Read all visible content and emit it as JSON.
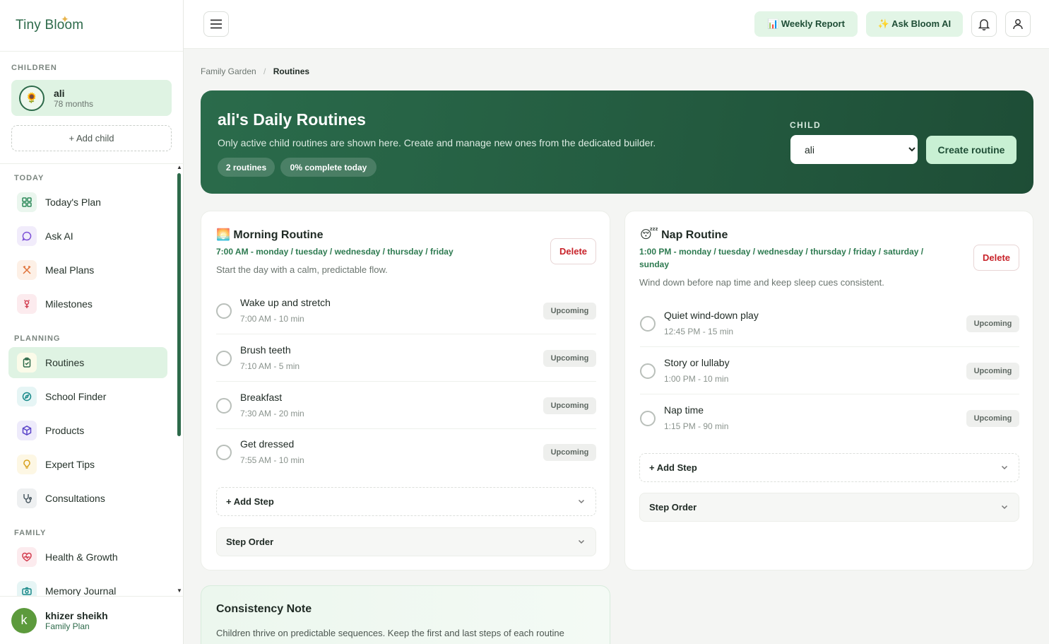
{
  "app": {
    "logo_text": "Tiny Bloom"
  },
  "sidebar": {
    "children_title": "CHILDREN",
    "child": {
      "name": "ali",
      "age": "78 months",
      "avatar": "🌻"
    },
    "add_child": "+ Add child",
    "sections": {
      "today": "TODAY",
      "planning": "PLANNING",
      "family": "FAMILY"
    },
    "items": [
      {
        "label": "Today's Plan",
        "icon": "grid-icon"
      },
      {
        "label": "Ask AI",
        "icon": "chat-icon"
      },
      {
        "label": "Meal Plans",
        "icon": "utensils-icon"
      },
      {
        "label": "Milestones",
        "icon": "flower-icon"
      },
      {
        "label": "Routines",
        "icon": "clipboard-icon"
      },
      {
        "label": "School Finder",
        "icon": "compass-icon"
      },
      {
        "label": "Products",
        "icon": "box-icon"
      },
      {
        "label": "Expert Tips",
        "icon": "lightbulb-icon"
      },
      {
        "label": "Consultations",
        "icon": "stethoscope-icon"
      },
      {
        "label": "Health & Growth",
        "icon": "heart-pulse-icon"
      },
      {
        "label": "Memory Journal",
        "icon": "camera-icon"
      }
    ],
    "user": {
      "initial": "k",
      "name": "khizer sheikh",
      "plan": "Family Plan"
    }
  },
  "topbar": {
    "weekly_report": "📊 Weekly Report",
    "ask_ai": "✨ Ask Bloom AI"
  },
  "breadcrumb": {
    "root": "Family Garden",
    "separator": "/",
    "current": "Routines"
  },
  "hero": {
    "title": "ali's Daily Routines",
    "subtitle": "Only active child routines are shown here. Create and manage new ones from the dedicated builder.",
    "chips": [
      "2 routines",
      "0% complete today"
    ],
    "child_label": "CHILD",
    "child_selected": "ali",
    "create_button": "Create routine"
  },
  "routines": [
    {
      "emoji": "🌅",
      "title": "Morning Routine",
      "schedule": "7:00 AM - monday / tuesday / wednesday / thursday / friday",
      "description": "Start the day with a calm, predictable flow.",
      "delete_label": "Delete",
      "steps": [
        {
          "name": "Wake up and stretch",
          "meta": "7:00 AM - 10 min",
          "status": "Upcoming"
        },
        {
          "name": "Brush teeth",
          "meta": "7:10 AM - 5 min",
          "status": "Upcoming"
        },
        {
          "name": "Breakfast",
          "meta": "7:30 AM - 20 min",
          "status": "Upcoming"
        },
        {
          "name": "Get dressed",
          "meta": "7:55 AM - 10 min",
          "status": "Upcoming"
        }
      ],
      "add_step": "+ Add Step",
      "step_order": "Step Order"
    },
    {
      "emoji": "😴",
      "title": "Nap Routine",
      "schedule": "1:00 PM - monday / tuesday / wednesday / thursday / friday / saturday / sunday",
      "description": "Wind down before nap time and keep sleep cues consistent.",
      "delete_label": "Delete",
      "steps": [
        {
          "name": "Quiet wind-down play",
          "meta": "12:45 PM - 15 min",
          "status": "Upcoming"
        },
        {
          "name": "Story or lullaby",
          "meta": "1:00 PM - 10 min",
          "status": "Upcoming"
        },
        {
          "name": "Nap time",
          "meta": "1:15 PM - 90 min",
          "status": "Upcoming"
        }
      ],
      "add_step": "+ Add Step",
      "step_order": "Step Order"
    }
  ],
  "note": {
    "title": "Consistency Note",
    "text": "Children thrive on predictable sequences. Keep the first and last steps of each routine"
  },
  "colors": {
    "brand": "#2d6a4a",
    "accent": "#dff3e3",
    "danger": "#c8232a"
  }
}
